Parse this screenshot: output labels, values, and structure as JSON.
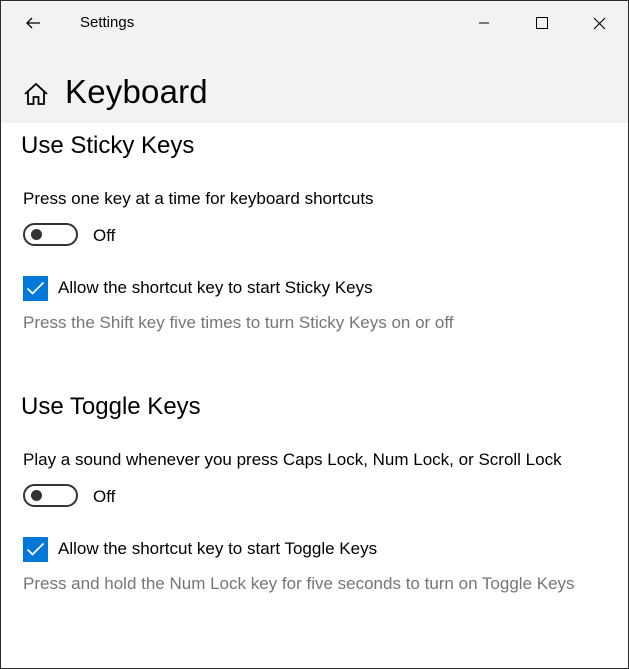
{
  "window": {
    "title": "Settings"
  },
  "header": {
    "page_title": "Keyboard"
  },
  "sticky_keys": {
    "heading": "Use Sticky Keys",
    "description": "Press one key at a time for keyboard shortcuts",
    "toggle_state": "Off",
    "checkbox_label": "Allow the shortcut key to start Sticky Keys",
    "checkbox_checked": true,
    "hint": "Press the Shift key five times to turn Sticky Keys on or off"
  },
  "toggle_keys": {
    "heading": "Use Toggle Keys",
    "description": "Play a sound whenever you press Caps Lock, Num Lock, or Scroll Lock",
    "toggle_state": "Off",
    "checkbox_label": "Allow the shortcut key to start Toggle Keys",
    "checkbox_checked": true,
    "hint": "Press and hold the Num Lock key for five seconds to turn on Toggle Keys"
  },
  "colors": {
    "accent": "#0078d7",
    "header_bg": "#f2f2f2",
    "hint_text": "#767676"
  },
  "icons": {
    "back": "back-arrow-icon",
    "minimize": "minimize-icon",
    "maximize": "maximize-icon",
    "close": "close-icon",
    "home": "home-icon",
    "check": "checkmark-icon"
  }
}
